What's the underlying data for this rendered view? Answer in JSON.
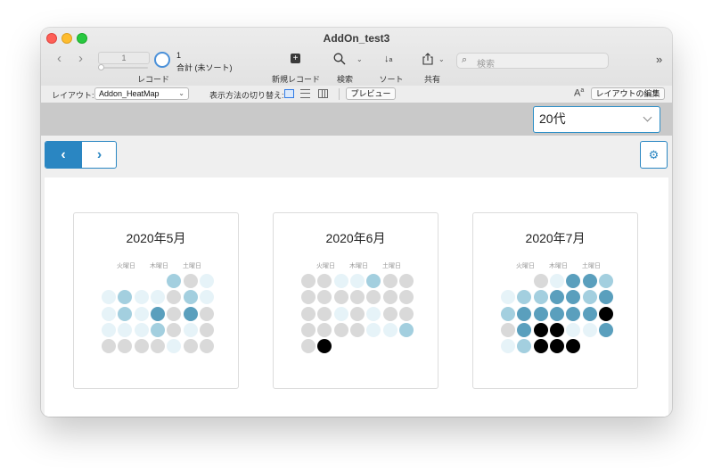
{
  "window": {
    "title": "AddOn_test3"
  },
  "toolbar": {
    "record_current": "1",
    "record_count": "1",
    "record_total": "合計 (未ソート)",
    "record_label": "レコード",
    "new_record_label": "新規レコード",
    "find_label": "検索",
    "sort_label": "ソート",
    "share_label": "共有",
    "search_placeholder": "検索"
  },
  "layoutbar": {
    "layout_label": "レイアウト:",
    "layout_value": "Addon_HeatMap",
    "view_as_label": "表示方法の切り替え:",
    "preview_label": "プレビュー",
    "edit_layout_label": "レイアウトの編集"
  },
  "filter": {
    "era_value": "20代"
  },
  "colors": {
    "empty": "#d9d9d9",
    "level1": "#e6f3f8",
    "level2": "#a3cfdf",
    "level3": "#5a9fbd",
    "level4": "#000000",
    "accent": "#2a86c2"
  },
  "calendars": [
    {
      "title": "2020年5月",
      "dow_labels": [
        "火曜日",
        "木曜日",
        "土曜日"
      ],
      "cells": [
        [
          null,
          null,
          null,
          null,
          2,
          0,
          1
        ],
        [
          1,
          2,
          1,
          1,
          0,
          2,
          1
        ],
        [
          1,
          2,
          1,
          3,
          0,
          3,
          0
        ],
        [
          1,
          1,
          1,
          2,
          0,
          1,
          0
        ],
        [
          0,
          0,
          0,
          0,
          1,
          0,
          0
        ]
      ]
    },
    {
      "title": "2020年6月",
      "dow_labels": [
        "火曜日",
        "木曜日",
        "土曜日"
      ],
      "cells": [
        [
          0,
          0,
          1,
          1,
          2,
          0,
          0
        ],
        [
          0,
          0,
          0,
          0,
          0,
          0,
          0
        ],
        [
          0,
          0,
          1,
          0,
          1,
          0,
          0
        ],
        [
          0,
          0,
          0,
          0,
          1,
          1,
          2
        ],
        [
          0,
          4,
          null,
          null,
          null,
          null,
          null
        ]
      ]
    },
    {
      "title": "2020年7月",
      "dow_labels": [
        "火曜日",
        "木曜日",
        "土曜日"
      ],
      "cells": [
        [
          null,
          null,
          0,
          1,
          3,
          3,
          2
        ],
        [
          1,
          2,
          2,
          3,
          3,
          2,
          3
        ],
        [
          2,
          3,
          3,
          3,
          3,
          3,
          4
        ],
        [
          0,
          3,
          4,
          4,
          1,
          1,
          3
        ],
        [
          1,
          2,
          4,
          4,
          4,
          null,
          null
        ]
      ]
    }
  ]
}
